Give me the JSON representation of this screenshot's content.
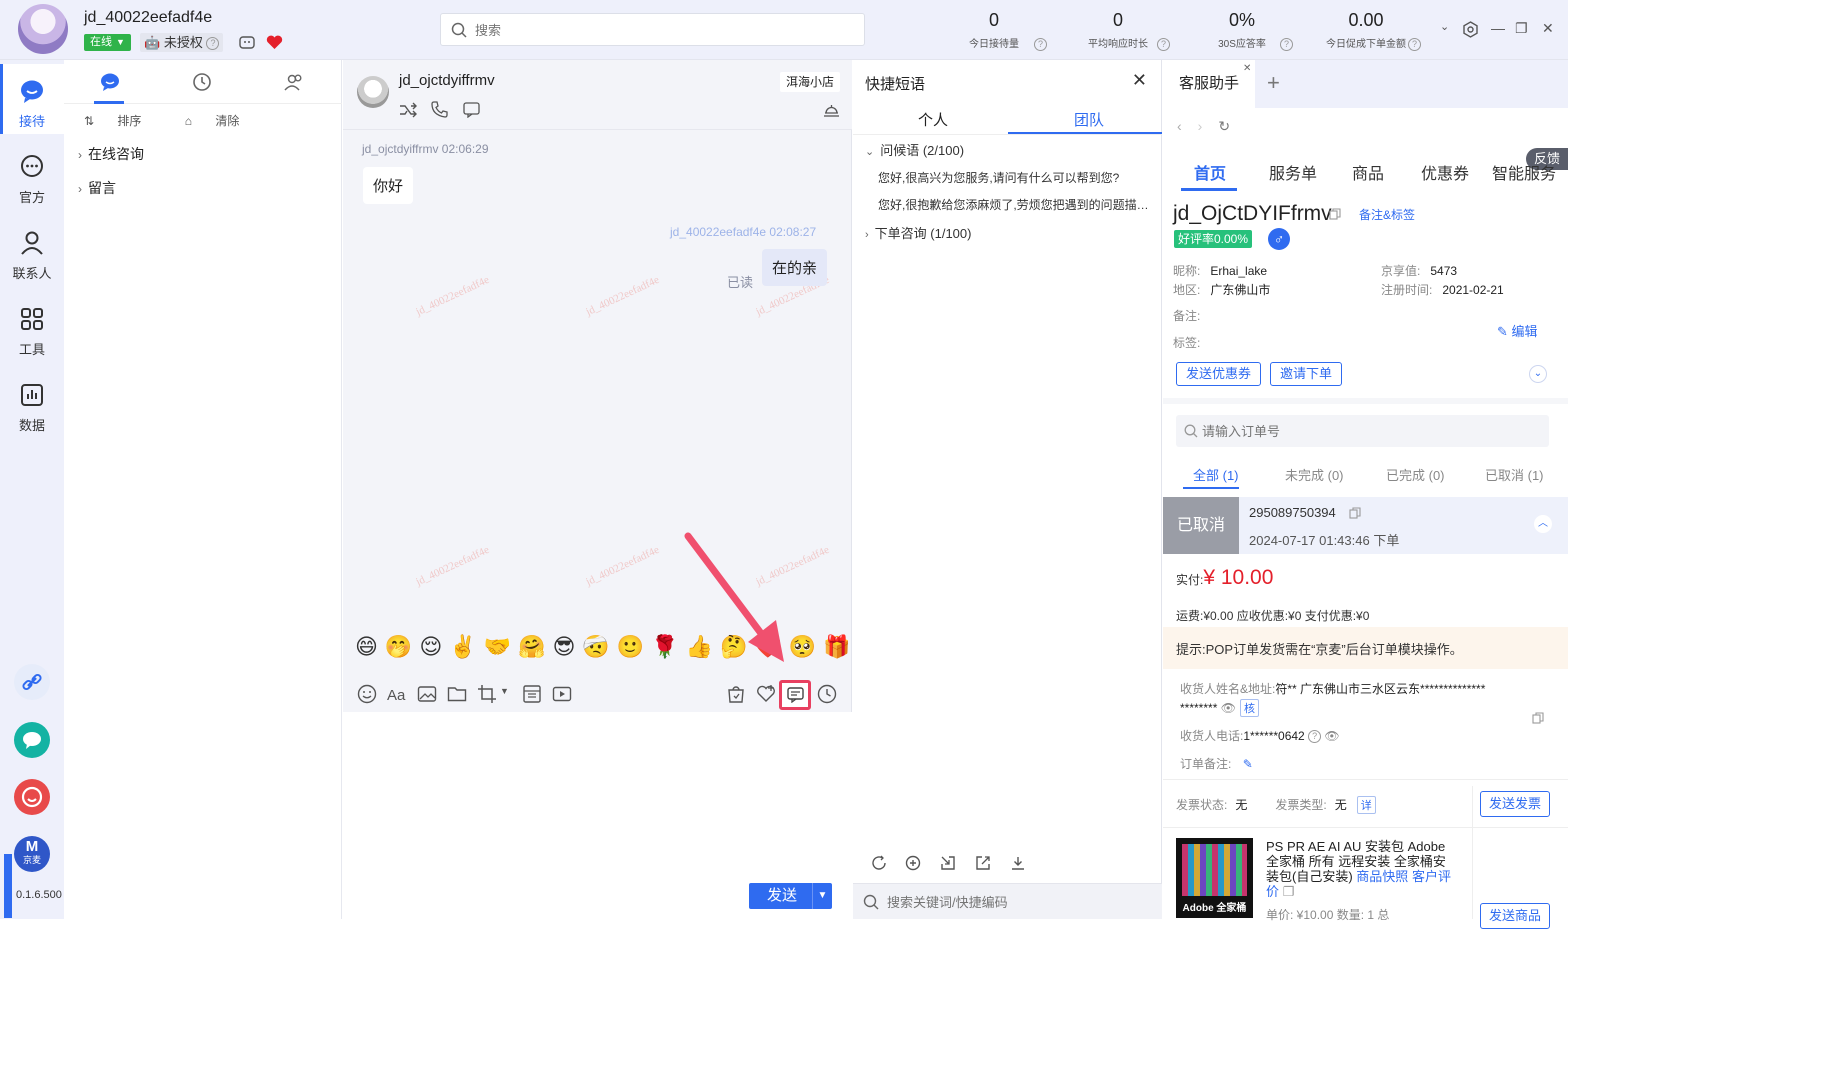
{
  "topbar": {
    "username": "jd_40022eefadf4e",
    "status": "在线",
    "auth": "未授权",
    "search_placeholder": "搜索",
    "stats": [
      {
        "value": "0",
        "label": "今日接待量"
      },
      {
        "value": "0",
        "label": "平均响应时长"
      },
      {
        "value": "0%",
        "label": "30S应答率"
      },
      {
        "value": "0.00",
        "label": "今日促成下单金额"
      }
    ]
  },
  "rail": {
    "items": [
      {
        "label": "接待"
      },
      {
        "label": "官方"
      },
      {
        "label": "联系人"
      },
      {
        "label": "工具"
      },
      {
        "label": "数据"
      }
    ],
    "bottom_badge": "M",
    "bottom_badge_sub": "京麦",
    "version": "0.1.6.500"
  },
  "list": {
    "sort_label": "排序",
    "clear_label": "清除",
    "groups": [
      "在线咨询",
      "留言"
    ]
  },
  "chat": {
    "contact_name": "jd_ojctdyiffrmv",
    "shop_tag": "洱海小店",
    "messages": [
      {
        "meta": "jd_ojctdyiffrmv 02:06:29",
        "text": "你好"
      },
      {
        "meta": "jd_40022eefadf4e 02:08:27",
        "text": "在的亲",
        "read": "已读"
      }
    ],
    "watermark": "jd_40022eefadf4e",
    "emojis": "😄🤭😌✌️🤝🤗😎🤕🙂🌹👍🤔❤️🥺🎁",
    "send_label": "发送"
  },
  "quick": {
    "title": "快捷短语",
    "tabs": [
      "个人",
      "团队"
    ],
    "groups": [
      {
        "label": "问候语 (2/100)",
        "items": [
          "您好,很高兴为您服务,请问有什么可以帮到您?",
          "您好,很抱歉给您添麻烦了,劳烦您把遇到的问题描述一下"
        ]
      },
      {
        "label": "下单咨询 (1/100)",
        "items": []
      }
    ],
    "search_placeholder": "搜索关键词/快捷编码"
  },
  "assistant": {
    "tab_label": "客服助手",
    "feedback": "反馈",
    "main_tabs": [
      "首页",
      "服务单",
      "商品",
      "优惠券",
      "智能服务"
    ],
    "customer_id": "jd_OjCtDYIFfrmv",
    "note_link": "备注&标签",
    "rating": "好评率0.00%",
    "nickname_label": "昵称:",
    "nickname": "Erhai_lake",
    "jingxiang_label": "京享值:",
    "jingxiang": "5473",
    "region_label": "地区:",
    "region": "广东佛山市",
    "register_label": "注册时间:",
    "register": "2021-02-21",
    "remark_label": "备注:",
    "tag_label": "标签:",
    "edit_label": "编辑",
    "btn_coupon": "发送优惠券",
    "btn_invite": "邀请下单",
    "order_search_placeholder": "请输入订单号",
    "order_tabs": [
      "全部 (1)",
      "未完成 (0)",
      "已完成 (0)",
      "已取消 (1)"
    ],
    "order": {
      "status": "已取消",
      "number": "295089750394",
      "time": "2024-07-17 01:43:46  下单",
      "paid_label": "实付:",
      "paid": "¥ 10.00",
      "fees": "运费:¥0.00    应收优惠:¥0        支付优惠:¥0",
      "tip": "提示:POP订单发货需在“京麦”后台订单模块操作。",
      "receiver_label": "收货人姓名&地址:",
      "receiver": "符** 广东佛山市三水区云东**************",
      "receiver2": "********",
      "verify": "核",
      "phone_label": "收货人电话:",
      "phone": "1******0642",
      "order_note_label": "订单备注:"
    },
    "invoice_status_label": "发票状态:",
    "invoice_status": "无",
    "invoice_type_label": "发票类型:",
    "invoice_type": "无",
    "invoice_detail": "详",
    "invoice_btn": "发送发票",
    "product": {
      "img_caption": "Adobe 全家桶",
      "title": "PS PR AE AI AU 安装包 Adobe全家桶 所有 远程安装 全家桶安装包(自己安装)",
      "snapshot": "商品快照",
      "review": "客户评价",
      "price": "单价:  ¥10.00     数量:  1   总",
      "btn": "发送商品"
    }
  }
}
